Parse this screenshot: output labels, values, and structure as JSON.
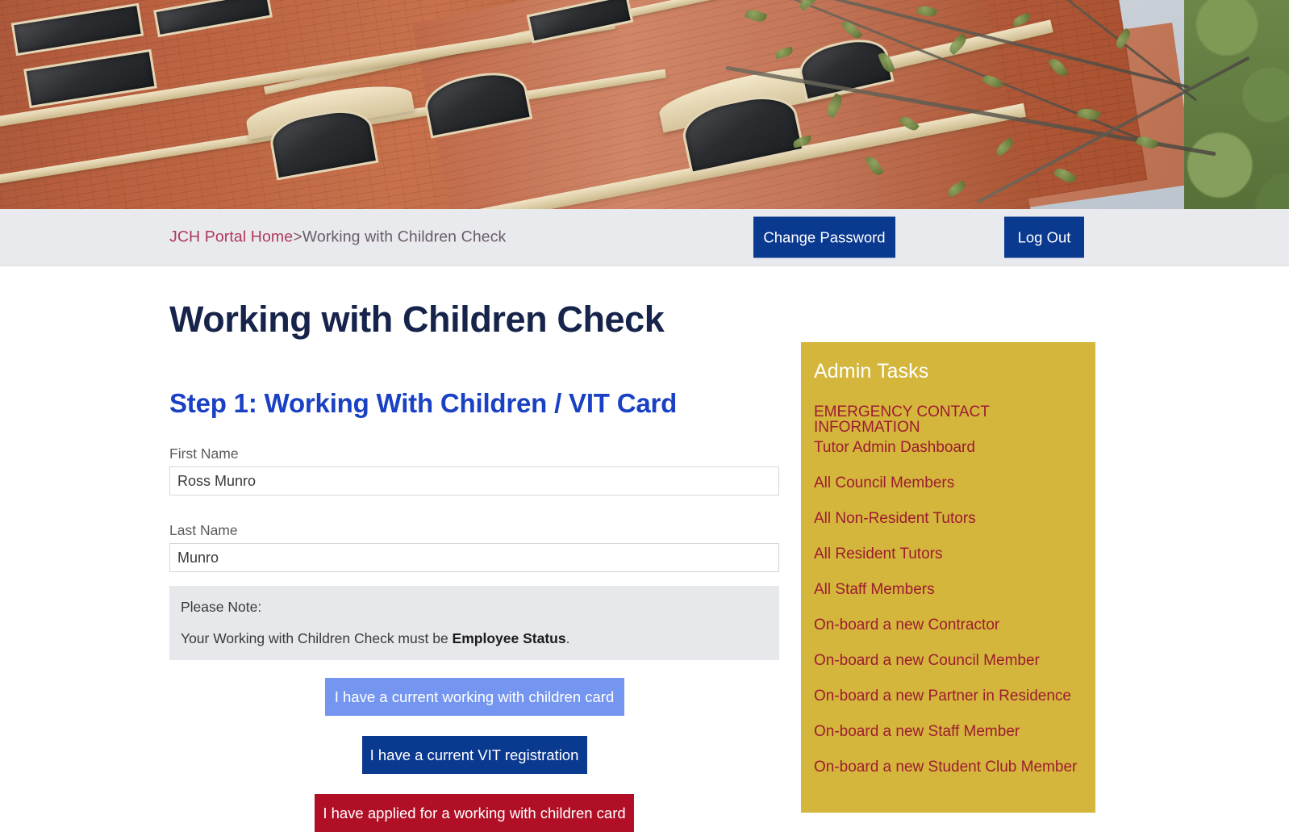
{
  "hero": {
    "alt": "photograph of red brick victorian college building with sandstone trim and tree branches",
    "icon": "building-photo-banner"
  },
  "navbar": {
    "breadcrumb": {
      "home_label": "JCH Portal Home",
      "separator": ">",
      "current_label": "Working with Children Check"
    },
    "change_password_label": "Change Password",
    "log_out_label": "Log Out",
    "button_color": "#0a3990",
    "background": "#e8eaee"
  },
  "main": {
    "page_title": "Working with Children Check",
    "step_title": "Step 1: Working With Children / VIT Card",
    "fields": [
      {
        "label": "First Name",
        "value": "Ross Munro",
        "placeholder": "First Name"
      },
      {
        "label": "Last Name",
        "value": "Munro",
        "placeholder": "Last Name"
      }
    ],
    "note": {
      "heading": "Please Note:",
      "text_before": "Your Working with Children Check must be ",
      "text_bold": "Employee Status",
      "text_after": "."
    },
    "options": [
      {
        "label": "I have a current working with children card",
        "color": "#7596f0"
      },
      {
        "label": "I have a current VIT registration",
        "color": "#0a3990"
      },
      {
        "label": "I have applied for a working with children card",
        "color": "#b00f26"
      }
    ]
  },
  "sidebar": {
    "title": "Admin Tasks",
    "background": "#d3b63b",
    "link_color": "#9e1b32",
    "items": [
      {
        "label": "EMERGENCY CONTACT INFORMATION"
      },
      {
        "label": "Tutor Admin Dashboard"
      },
      {
        "label": "All Council Members"
      },
      {
        "label": "All Non-Resident Tutors"
      },
      {
        "label": "All Resident Tutors"
      },
      {
        "label": "All Staff Members"
      },
      {
        "label": "On-board a new Contractor"
      },
      {
        "label": "On-board a new Council Member"
      },
      {
        "label": "On-board a new Partner in Residence"
      },
      {
        "label": "On-board a new Staff Member"
      },
      {
        "label": "On-board a new Student Club Member"
      }
    ]
  }
}
